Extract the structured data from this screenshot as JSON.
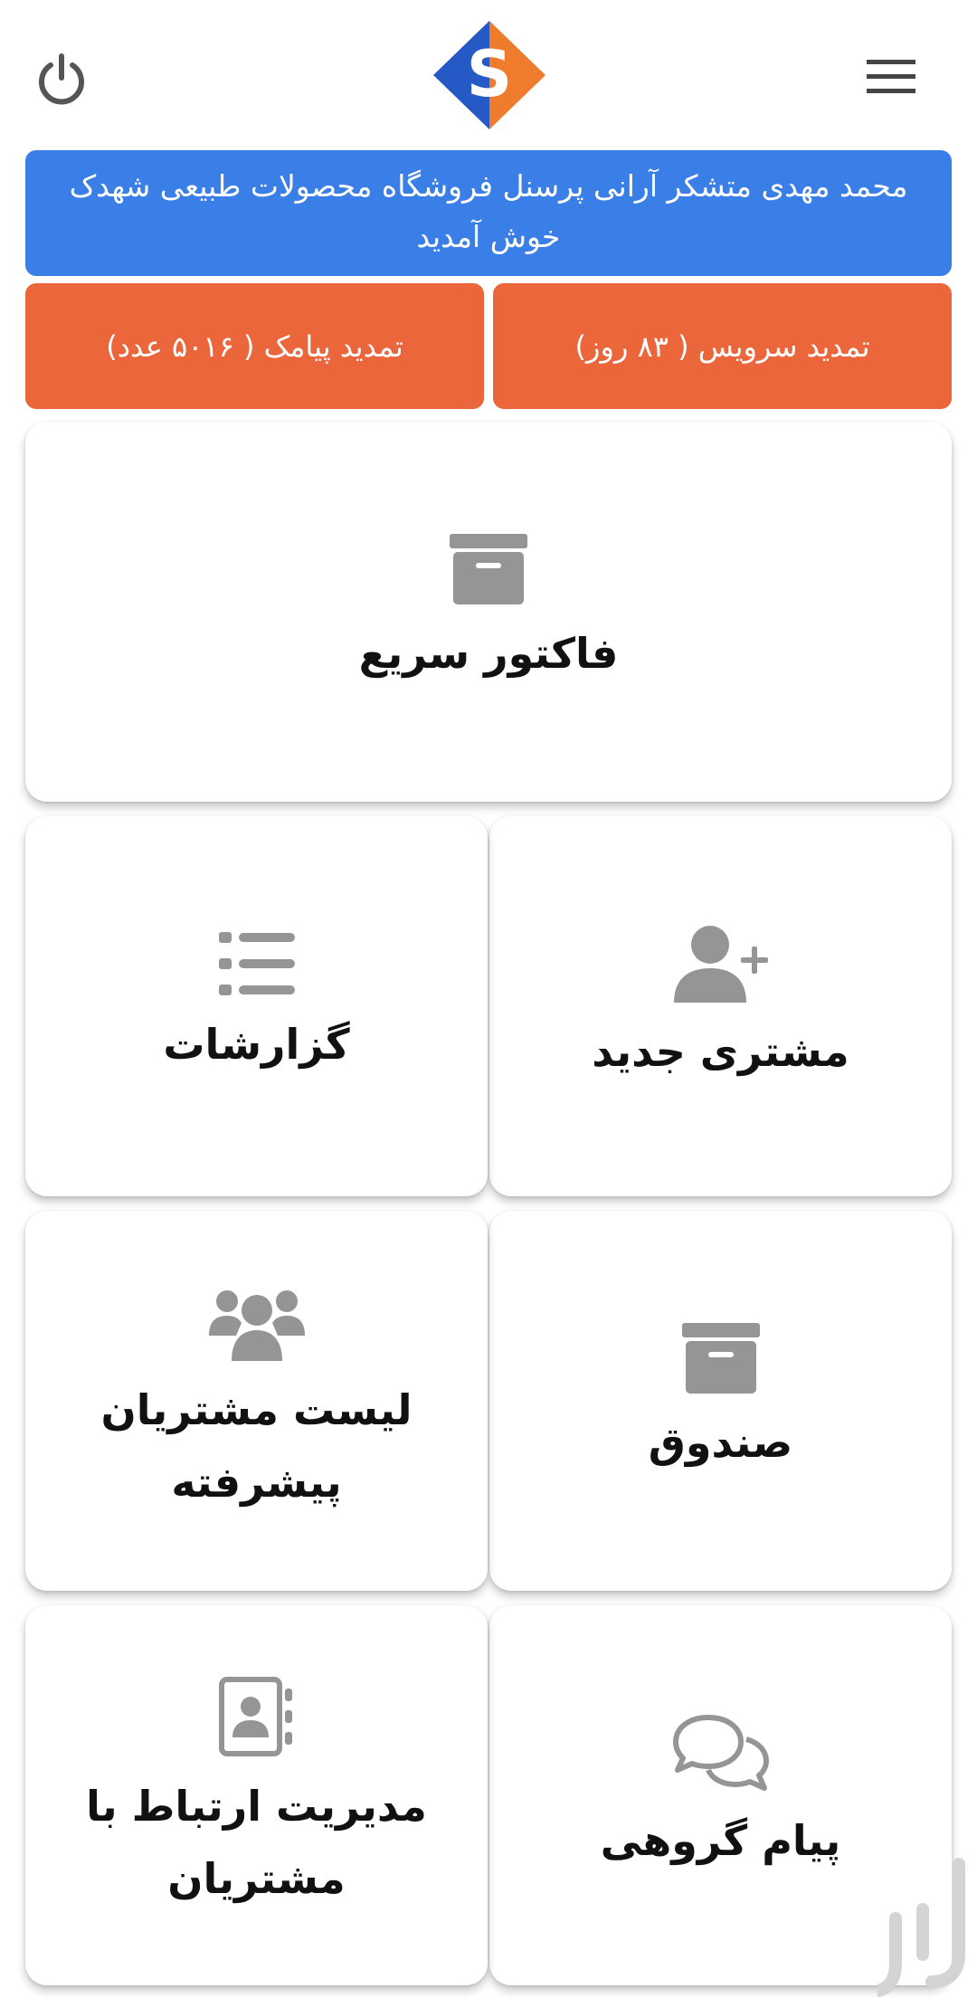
{
  "header": {
    "power_icon": "power-icon",
    "menu_icon": "hamburger-menu-icon",
    "logo_letter": "S",
    "colors": {
      "logo_blue": "#2459c6",
      "logo_orange": "#ef7c2c"
    }
  },
  "welcome": {
    "line1": "محمد مهدی متشکر آرانی پرسنل فروشگاه محصولات طبیعی شهدک",
    "line2": "خوش آمدید",
    "color": "#3a7ee8"
  },
  "renewals": {
    "service_label": "تمدید سرویس ( ۸۳ روز)",
    "sms_label": "تمدید پیامک ( ۵۰۱۶ عدد)",
    "color": "#ec663b"
  },
  "cards": {
    "fast_invoice": {
      "label": "فاکتور سریع",
      "icon": "archive-box-icon"
    },
    "new_customer": {
      "label": "مشتری جدید",
      "icon": "user-plus-icon"
    },
    "reports": {
      "label": "گزارشات",
      "icon": "list-icon"
    },
    "cash_box": {
      "label": "صندوق",
      "icon": "archive-box-icon"
    },
    "advanced_customer_list": {
      "label": "لیست مشتریان پیشرفته",
      "icon": "users-group-icon"
    },
    "group_message": {
      "label": "پیام گروهی",
      "icon": "chat-bubbles-icon"
    },
    "customer_relations": {
      "label": "مدیریت ارتباط با مشتریان",
      "icon": "address-book-icon"
    }
  },
  "watermark": {
    "icon": "cafebazaar-watermark-icon"
  }
}
